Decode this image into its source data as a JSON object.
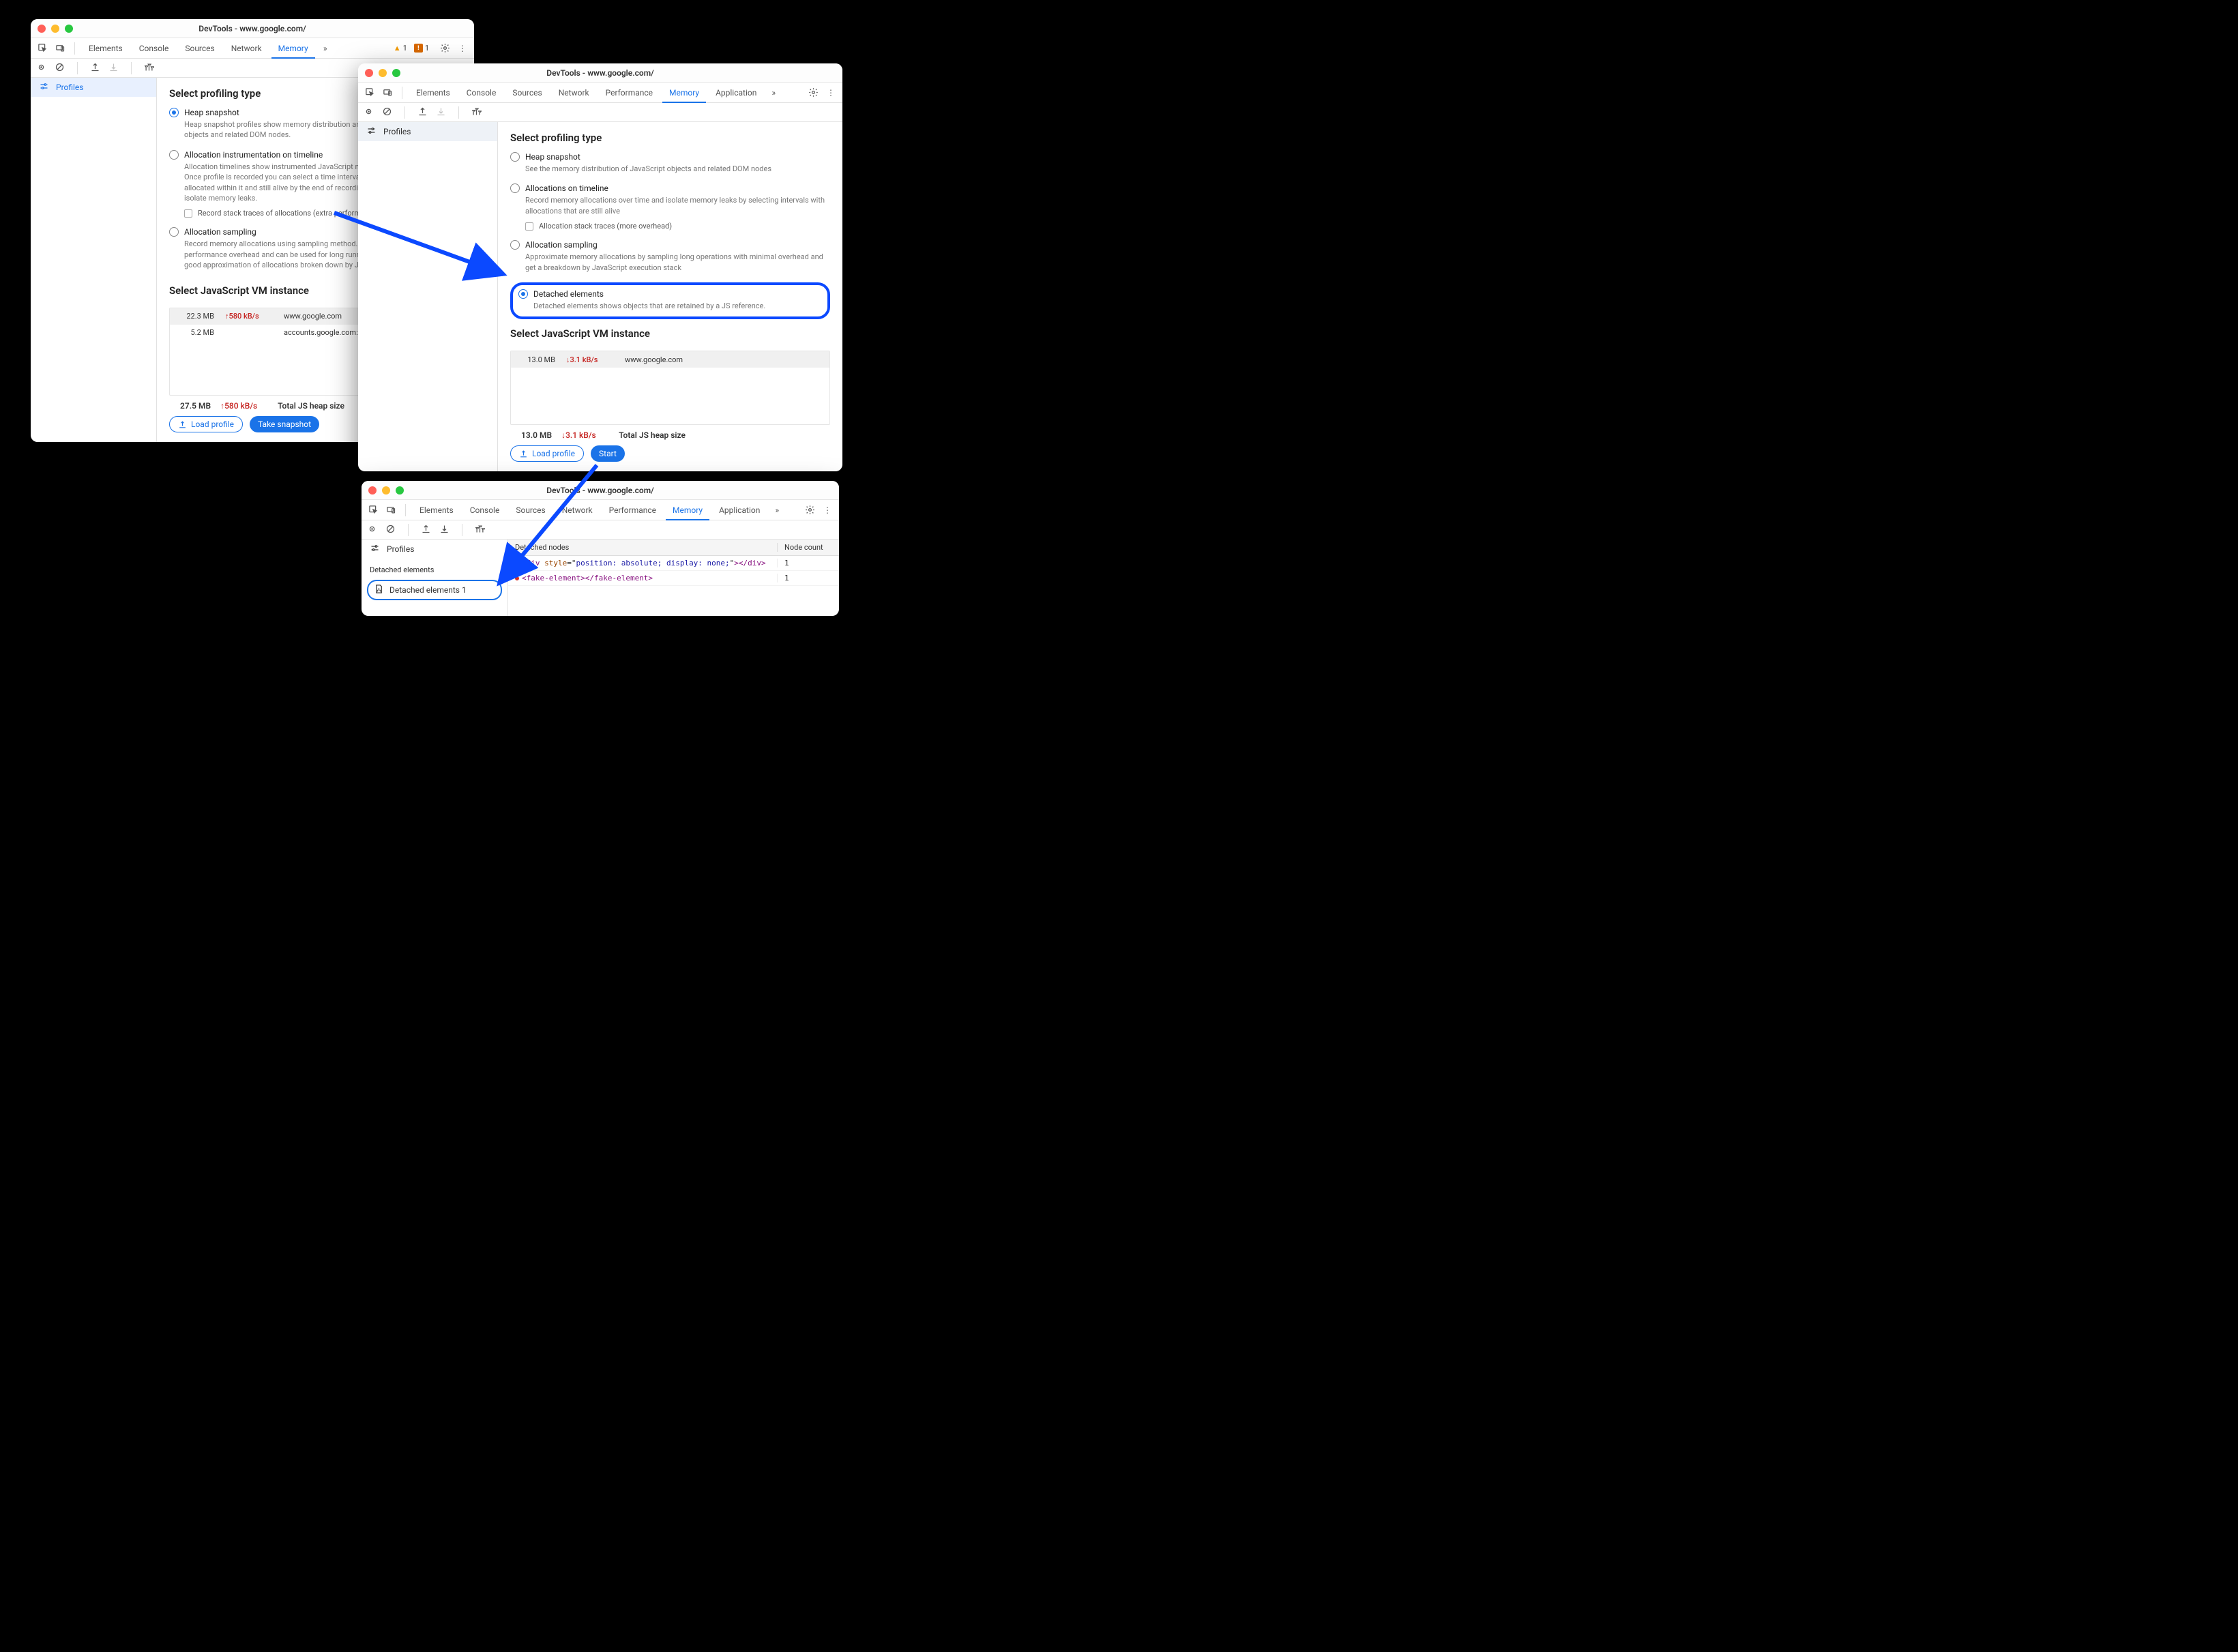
{
  "window1": {
    "title": "DevTools - www.google.com/",
    "tabs": [
      "Elements",
      "Console",
      "Sources",
      "Network",
      "Memory"
    ],
    "active_tab": "Memory",
    "warning_triangle_count": "1",
    "warning_badge_count": "1",
    "sidebar": {
      "profiles_label": "Profiles"
    },
    "profiling_heading": "Select profiling type",
    "options": {
      "heap": {
        "title": "Heap snapshot",
        "desc": "Heap snapshot profiles show memory distribution among your page's JavaScript objects and related DOM nodes."
      },
      "timeline": {
        "title": "Allocation instrumentation on timeline",
        "desc": "Allocation timelines show instrumented JavaScript memory allocations over time. Once profile is recorded you can select a time interval to see objects that were allocated within it and still alive by the end of recording. Use this profile type to isolate memory leaks.",
        "check_label": "Record stack traces of allocations (extra performance overhead)"
      },
      "sampling": {
        "title": "Allocation sampling",
        "desc": "Record memory allocations using sampling method. This profile type has minimal performance overhead and can be used for long running operations. It provides good approximation of allocations broken down by JavaScript execution stack."
      }
    },
    "vm_heading": "Select JavaScript VM instance",
    "vm_rows": [
      {
        "size": "22.3 MB",
        "rate": "↑580 kB/s",
        "url": "www.google.com"
      },
      {
        "size": "5.2 MB",
        "rate": "",
        "url": "accounts.google.com: Root"
      }
    ],
    "footer": {
      "total_mb": "27.5 MB",
      "total_rate": "↑580 kB/s",
      "total_label": "Total JS heap size",
      "load_label": "Load profile",
      "action_label": "Take snapshot"
    }
  },
  "window2": {
    "title": "DevTools - www.google.com/",
    "tabs": [
      "Elements",
      "Console",
      "Sources",
      "Network",
      "Performance",
      "Memory",
      "Application"
    ],
    "active_tab": "Memory",
    "sidebar": {
      "profiles_label": "Profiles"
    },
    "profiling_heading": "Select profiling type",
    "options": {
      "heap": {
        "title": "Heap snapshot",
        "desc": "See the memory distribution of JavaScript objects and related DOM nodes"
      },
      "timeline": {
        "title": "Allocations on timeline",
        "desc": "Record memory allocations over time and isolate memory leaks by selecting intervals with allocations that are still alive",
        "check_label": "Allocation stack traces (more overhead)"
      },
      "sampling": {
        "title": "Allocation sampling",
        "desc": "Approximate memory allocations by sampling long operations with minimal overhead and get a breakdown by JavaScript execution stack"
      },
      "detached": {
        "title": "Detached elements",
        "desc": "Detached elements shows objects that are retained by a JS reference."
      }
    },
    "vm_heading": "Select JavaScript VM instance",
    "vm_rows": [
      {
        "size": "13.0 MB",
        "rate": "↓3.1 kB/s",
        "url": "www.google.com"
      }
    ],
    "footer": {
      "total_mb": "13.0 MB",
      "total_rate": "↓3.1 kB/s",
      "total_label": "Total JS heap size",
      "load_label": "Load profile",
      "action_label": "Start"
    }
  },
  "window3": {
    "title": "DevTools - www.google.com/",
    "tabs": [
      "Elements",
      "Console",
      "Sources",
      "Network",
      "Performance",
      "Memory",
      "Application"
    ],
    "active_tab": "Memory",
    "sidebar": {
      "profiles_label": "Profiles",
      "section_label": "Detached elements",
      "profile_item": "Detached elements 1"
    },
    "results": {
      "header_nodes": "Detached nodes",
      "header_count": "Node count",
      "rows": [
        {
          "html": "<div style=\"position: absolute; display: none;\"></div>",
          "count": "1"
        },
        {
          "html": "<fake-element></fake-element>",
          "count": "1"
        }
      ]
    }
  }
}
